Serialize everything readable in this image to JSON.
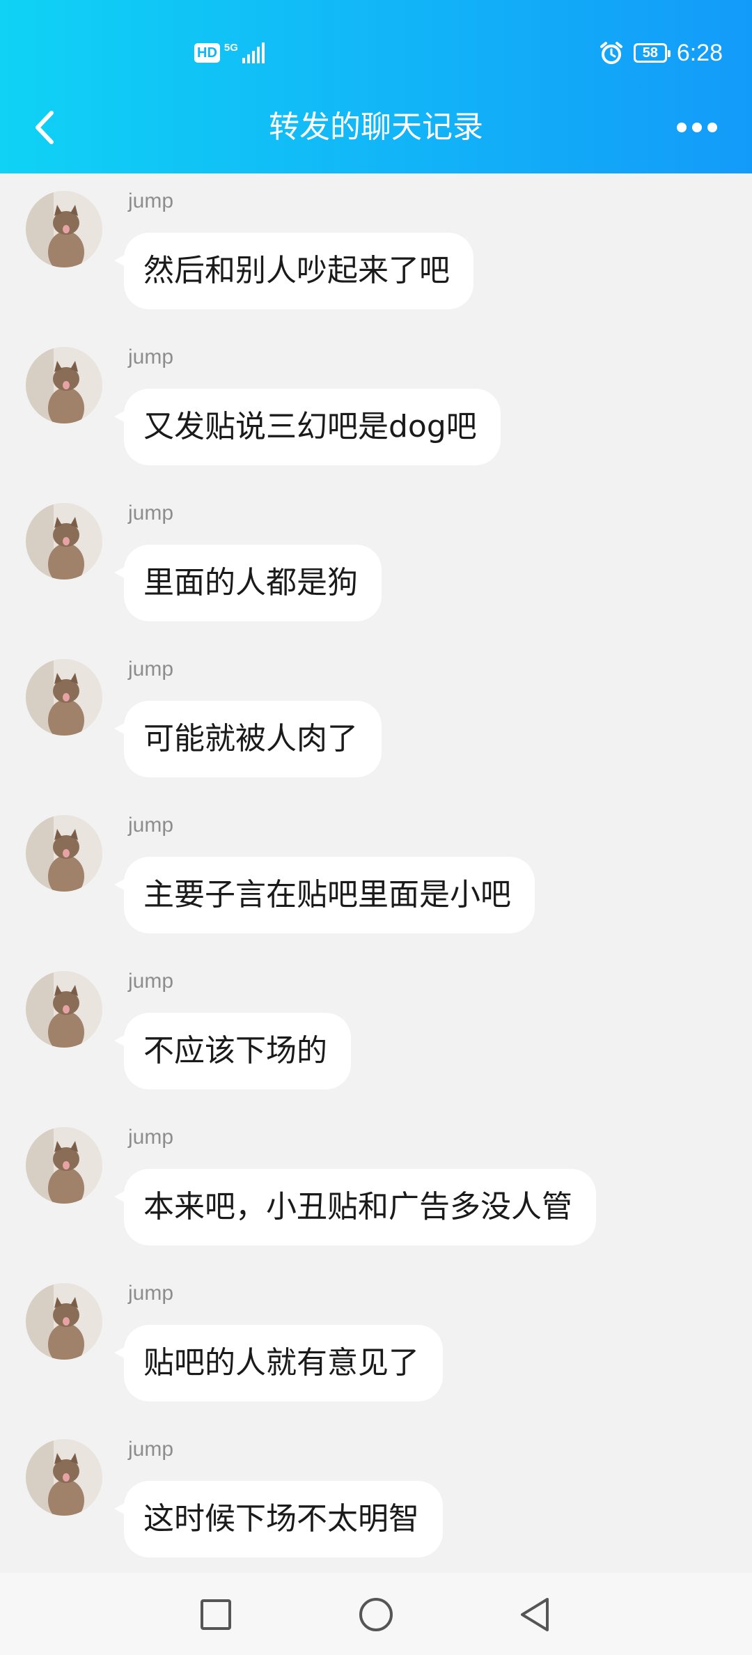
{
  "status_bar": {
    "hd_label": "HD",
    "network_label": "5G",
    "battery": "58",
    "time": "6:28"
  },
  "header": {
    "title": "转发的聊天记录",
    "back_icon": "chevron-left-icon",
    "more_icon": "more-horizontal-icon"
  },
  "messages": [
    {
      "sender": "jump",
      "text": "然后和别人吵起来了吧"
    },
    {
      "sender": "jump",
      "text": "又发贴说三幻吧是dog吧"
    },
    {
      "sender": "jump",
      "text": "里面的人都是狗"
    },
    {
      "sender": "jump",
      "text": "可能就被人肉了"
    },
    {
      "sender": "jump",
      "text": "主要子言在贴吧里面是小吧"
    },
    {
      "sender": "jump",
      "text": "不应该下场的"
    },
    {
      "sender": "jump",
      "text": "本来吧，小丑贴和广告多没人管"
    },
    {
      "sender": "jump",
      "text": "贴吧的人就有意见了"
    },
    {
      "sender": "jump",
      "text": "这时候下场不太明智"
    }
  ],
  "nav_bar": {
    "recents_icon": "square-icon",
    "home_icon": "circle-icon",
    "back_icon": "triangle-back-icon"
  },
  "colors": {
    "header_gradient_start": "#0fd2f5",
    "header_gradient_end": "#139bf9",
    "background": "#f2f2f2",
    "bubble": "#ffffff",
    "sender_text": "#8d8d8d"
  }
}
